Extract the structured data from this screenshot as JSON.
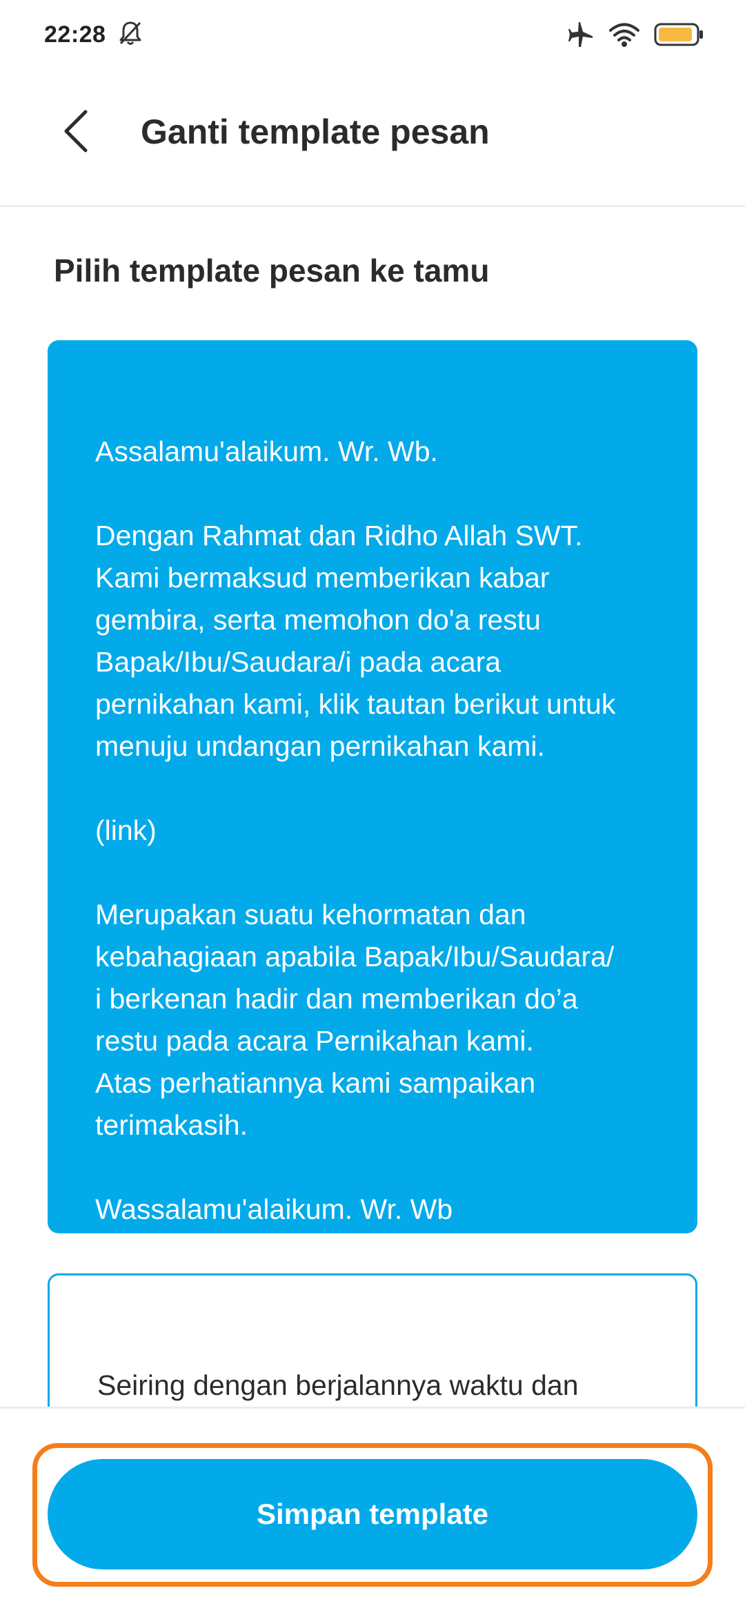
{
  "status_bar": {
    "time": "22:28",
    "icons": [
      "bell-off-icon",
      "airplane-icon",
      "wifi-icon",
      "battery-icon"
    ],
    "battery_color": "#f5b942"
  },
  "header": {
    "back_icon": "chevron-left-icon",
    "title": "Ganti template pesan"
  },
  "main": {
    "section_title": "Pilih template pesan ke tamu",
    "templates": [
      {
        "selected": true,
        "text": "Assalamu'alaikum. Wr. Wb.\n\nDengan Rahmat dan Ridho Allah SWT.\nKami bermaksud memberikan kabar\ngembira, serta memohon do'a restu\nBapak/Ibu/Saudara/i pada acara\npernikahan kami, klik tautan berikut untuk\nmenuju undangan pernikahan kami.\n\n(link)\n\nMerupakan suatu kehormatan dan\nkebahagiaan apabila Bapak/Ibu/Saudara/\ni berkenan hadir dan memberikan do’a\nrestu pada acara Pernikahan kami.\nAtas perhatiannya kami sampaikan\nterimakasih.\n\nWassalamu'alaikum. Wr. Wb"
      },
      {
        "selected": false,
        "text": "Seiring dengan berjalannya waktu dan\npergantian hari,"
      }
    ]
  },
  "footer": {
    "save_label": "Simpan template"
  },
  "colors": {
    "accent": "#02aaea",
    "highlight": "#f47e1a",
    "text": "#2b2b2b"
  }
}
